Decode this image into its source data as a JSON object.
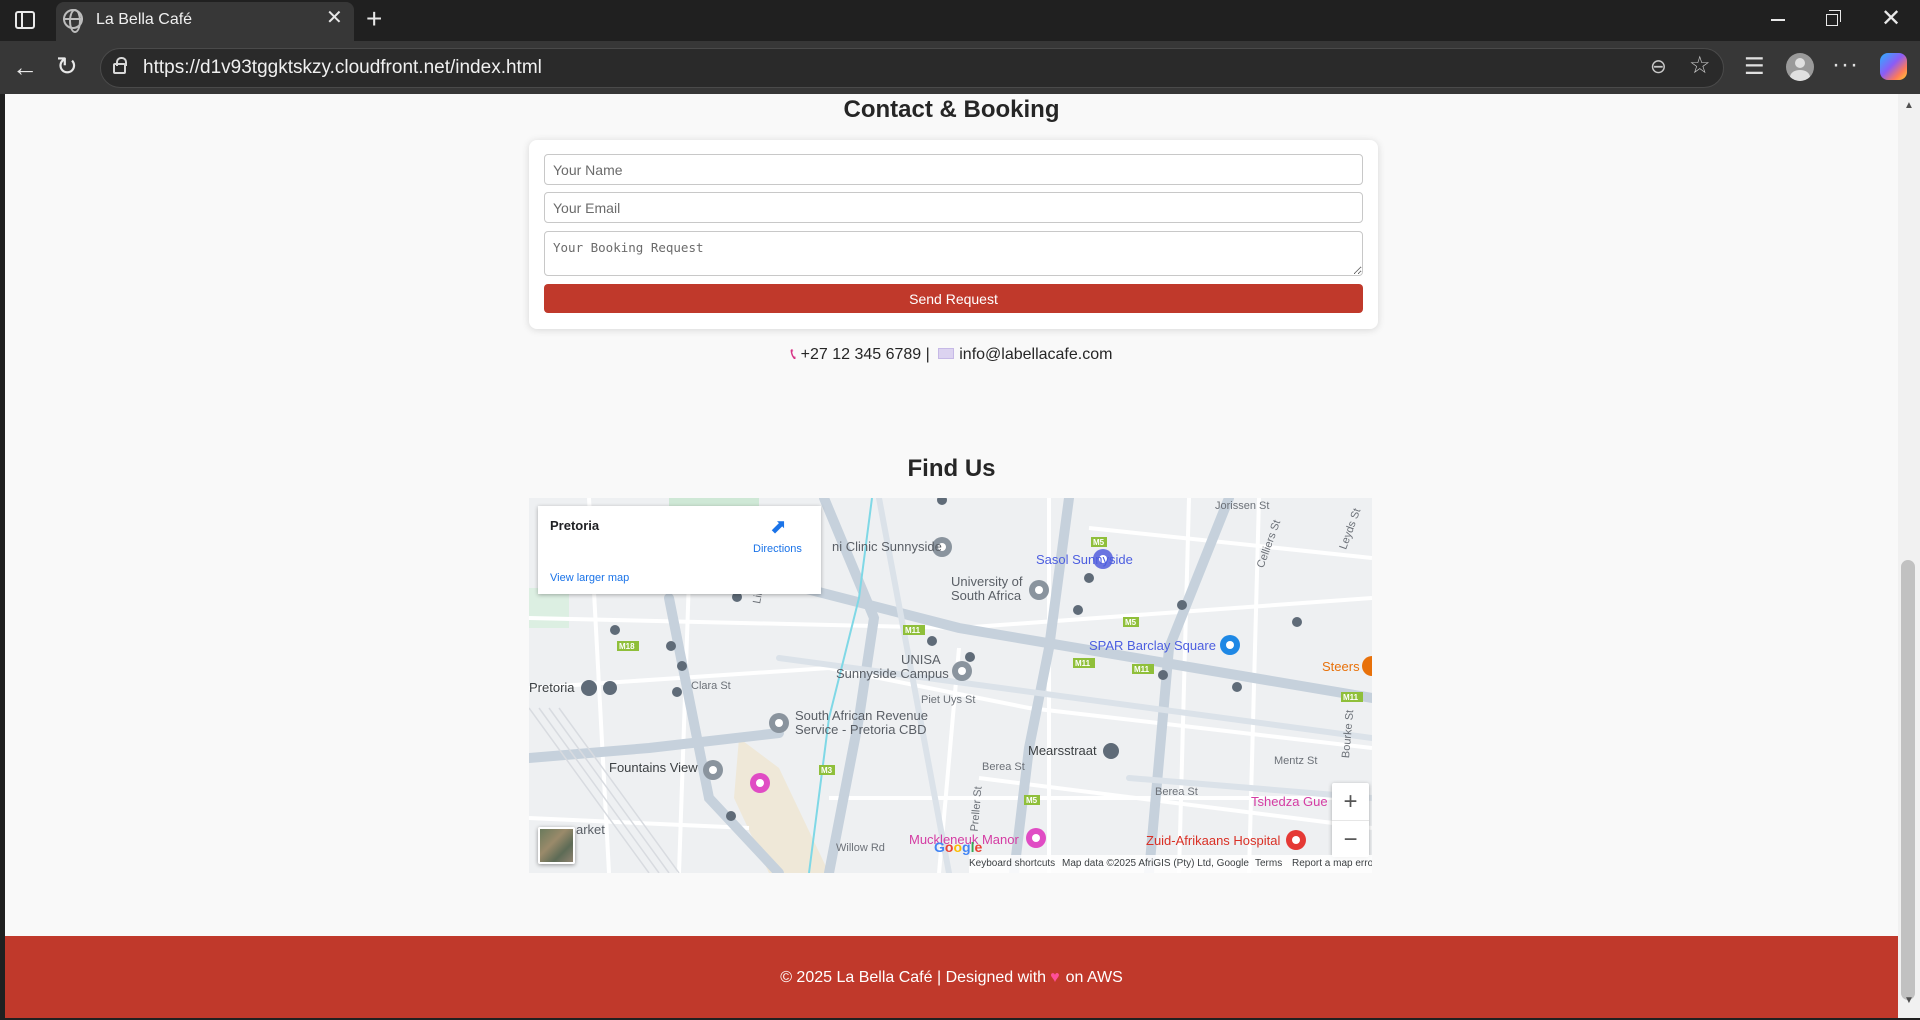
{
  "browser": {
    "tab_title": "La Bella Café",
    "url": "https://d1v93tggktskzy.cloudfront.net/index.html"
  },
  "contact": {
    "title": "Contact & Booking",
    "name_placeholder": "Your Name",
    "email_placeholder": "Your Email",
    "message_placeholder": "Your Booking Request",
    "send_label": "Send Request",
    "phone": "+27 12 345 6789",
    "separator": "|",
    "email": "info@labellacafe.com"
  },
  "find_us": {
    "title": "Find Us",
    "map": {
      "place": "Pretoria",
      "directions_label": "Directions",
      "larger_map_label": "View larger map",
      "zoom_in": "+",
      "zoom_out": "−",
      "labels": {
        "clinic": "ni Clinic Sunnyside",
        "sasol": "Sasol Sunnyside",
        "univ1": "University of",
        "univ2": "South Africa",
        "spar": "SPAR Barclay Square",
        "steers": "Steers",
        "unisa1": "UNISA",
        "unisa2": "Sunnyside Campus",
        "pretoria": "Pretoria",
        "clara": "Clara St",
        "sars1": "South African Revenue",
        "sars2": "Service - Pretoria CBD",
        "pietuys": "Piet Uys St",
        "mearsstraat": "Mearsstraat",
        "fountains": "Fountains View",
        "berea1": "Berea St",
        "berea2": "Berea St",
        "mentz": "Mentz St",
        "tshedza": "Tshedza Gue",
        "muckleneuk": "Muckleneuk Manor",
        "zuid": "Zuid-Afrikaans Hospital",
        "market": "arket",
        "willow": "Willow Rd",
        "jorissen": "Jorissen St",
        "celliers": "Celliers St",
        "leyds": "Leyds St",
        "bourke": "Bourke St",
        "preller": "Preller St",
        "lilia": "Lilia"
      },
      "google": "Google",
      "attribution": {
        "shortcuts": "Keyboard shortcuts",
        "map_data": "Map data ©2025 AfriGIS (Pty) Ltd, Google",
        "terms": "Terms",
        "report": "Report a map error"
      }
    }
  },
  "footer": {
    "text_before": "© 2025 La Bella Café | Designed with",
    "text_after": "on AWS"
  },
  "icons": {
    "phone": "phone-icon",
    "mail": "envelope-icon",
    "heart": "heart-icon"
  },
  "colors": {
    "accent": "#c0392b",
    "page_bg": "#f9f9f9",
    "link": "#1a73e8"
  }
}
